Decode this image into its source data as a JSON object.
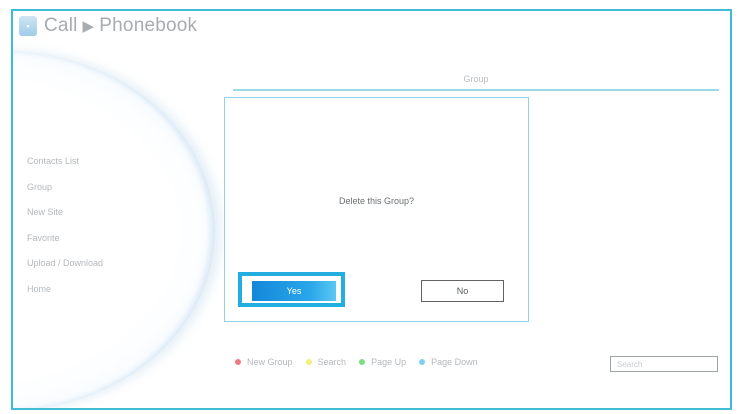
{
  "breadcrumb": {
    "app": "Call",
    "separator": "▶",
    "page": "Phonebook"
  },
  "section_title": "Group",
  "sidebar": {
    "items": [
      {
        "label": "Contacts List"
      },
      {
        "label": "Group"
      },
      {
        "label": "New Site"
      },
      {
        "label": "Favorite"
      },
      {
        "label": "Upload / Download"
      },
      {
        "label": "Home"
      }
    ]
  },
  "dialog": {
    "message": "Delete this Group?",
    "yes_label": "Yes",
    "no_label": "No"
  },
  "softkeys": [
    {
      "label": "New Group",
      "color": "#f07a84"
    },
    {
      "label": "Search",
      "color": "#f3ef7c"
    },
    {
      "label": "Page Up",
      "color": "#7ddc86"
    },
    {
      "label": "Page Down",
      "color": "#7fd0f2"
    }
  ],
  "search": {
    "placeholder": "Search"
  },
  "colors": {
    "accent": "#22aee0",
    "frame": "#3fbcd6",
    "yes_button": "#1f98e2"
  }
}
